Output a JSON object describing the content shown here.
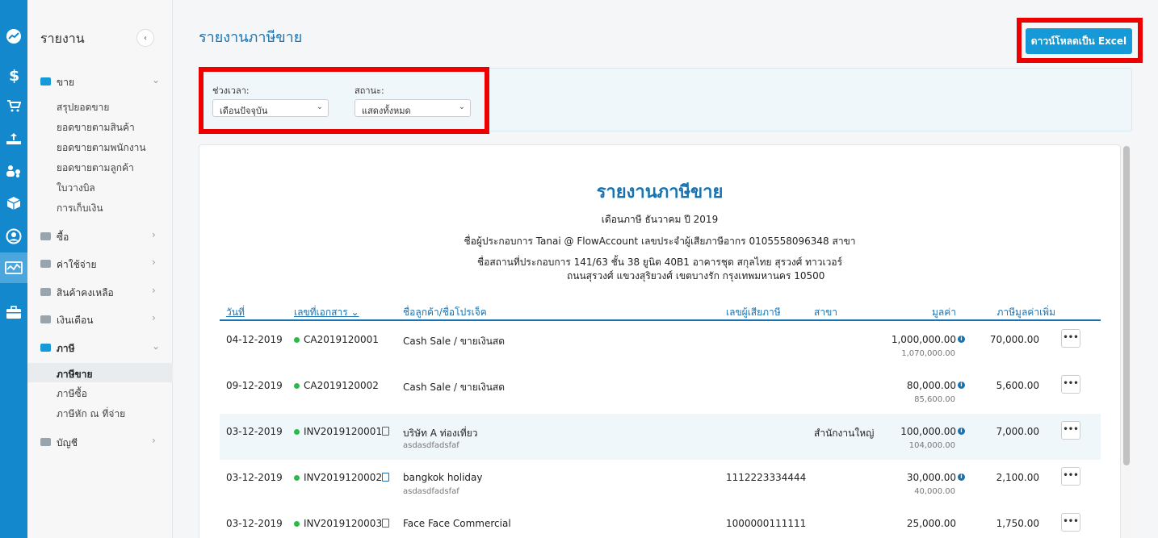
{
  "rail": {
    "items": [
      "dashboard-icon",
      "dollar-icon",
      "cart-icon",
      "upload-tray-icon",
      "people-coins-icon",
      "box-icon",
      "user-circle-icon",
      "report-chart-icon",
      "briefcase-icon"
    ],
    "active_index": 7,
    "color": "#1488cc"
  },
  "sidebar": {
    "title": "รายงาน",
    "collapse_symbol": "‹",
    "sections": [
      {
        "label": "ขาย",
        "expanded": true,
        "items": [
          "สรุปยอดขาย",
          "ยอดขายตามสินค้า",
          "ยอดขายตามพนักงาน",
          "ยอดขายตามลูกค้า",
          "ใบวางบิล",
          "การเก็บเงิน"
        ]
      },
      {
        "label": "ซื้อ",
        "expanded": false
      },
      {
        "label": "ค่าใช้จ่าย",
        "expanded": false
      },
      {
        "label": "สินค้าคงเหลือ",
        "expanded": false
      },
      {
        "label": "เงินเดือน",
        "expanded": false
      },
      {
        "label": "ภาษี",
        "expanded": true,
        "items": [
          "ภาษีขาย",
          "ภาษีซื้อ",
          "ภาษีหัก ณ ที่จ่าย"
        ],
        "active_item": "ภาษีขาย"
      },
      {
        "label": "บัญชี",
        "expanded": false
      }
    ]
  },
  "header": {
    "title": "รายงานภาษีขาย",
    "download_button": "ดาวน์โหลดเป็น Excel",
    "accent": "#1699d7"
  },
  "filters": {
    "period_label": "ช่วงเวลา:",
    "period_value": "เดือนปัจจุบัน",
    "status_label": "สถานะ:",
    "status_value": "แสดงทั้งหมด"
  },
  "report": {
    "title": "รายงานภาษีขาย",
    "tax_month": "เดือนภาษี ธันวาคม ปี 2019",
    "operator_line": "ชื่อผู้ประกอบการ Tanai @ FlowAccount เลขประจำผู้เสียภาษีอากร 0105558096348 สาขา",
    "address_line1": "ชื่อสถานที่ประกอบการ 141/63 ชั้น 38 ยูนิต 40B1 อาคารชุด สกุลไทย สุรวงศ์ ทาวเวอร์",
    "address_line2": "ถนนสุรวงศ์ แขวงสุริยวงศ์ เขตบางรัก กรุงเทพมหานคร 10500",
    "columns": {
      "date": "วันที่",
      "doc_no": "เลขที่เอกสาร",
      "customer": "ชื่อลูกค้า/ชื่อโปรเจ็ค",
      "tax_id": "เลขผู้เสียภาษี",
      "branch": "สาขา",
      "amount": "มูลค่า",
      "vat": "ภาษีมูลค่าเพิ่ม"
    },
    "rows": [
      {
        "date": "04-12-2019",
        "doc_no": "CA2019120001",
        "customer": "Cash Sale / ขายเงินสด",
        "project": "",
        "tax_id": "",
        "branch": "",
        "amount": "1,000,000.00",
        "amount_total": "1,070,000.00",
        "vat": "70,000.00",
        "has_doc_icon": false,
        "has_info": true
      },
      {
        "date": "09-12-2019",
        "doc_no": "CA2019120002",
        "customer": "Cash Sale / ขายเงินสด",
        "project": "",
        "tax_id": "",
        "branch": "",
        "amount": "80,000.00",
        "amount_total": "85,600.00",
        "vat": "5,600.00",
        "has_doc_icon": false,
        "has_info": true
      },
      {
        "date": "03-12-2019",
        "doc_no": "INV2019120001",
        "customer": "บริษัท A ท่องเที่ยว",
        "project": "asdasdfadsfaf",
        "tax_id": "",
        "branch": "สำนักงานใหญ่",
        "amount": "100,000.00",
        "amount_total": "104,000.00",
        "vat": "7,000.00",
        "has_doc_icon": true,
        "has_info": true
      },
      {
        "date": "03-12-2019",
        "doc_no": "INV2019120002",
        "customer": "bangkok holiday",
        "project": "asdasdfadsfaf",
        "tax_id": "1112223334444",
        "branch": "",
        "amount": "30,000.00",
        "amount_total": "40,000.00",
        "vat": "2,100.00",
        "has_doc_icon": true,
        "has_info": true
      },
      {
        "date": "03-12-2019",
        "doc_no": "INV2019120003",
        "customer": "Face Face Commercial",
        "project": "",
        "tax_id": "1000000111111",
        "branch": "",
        "amount": "25,000.00",
        "amount_total": "",
        "vat": "1,750.00",
        "has_doc_icon": true,
        "has_info": false
      }
    ],
    "more_symbol": "•••",
    "status_dot_color": "#2eb84b"
  }
}
